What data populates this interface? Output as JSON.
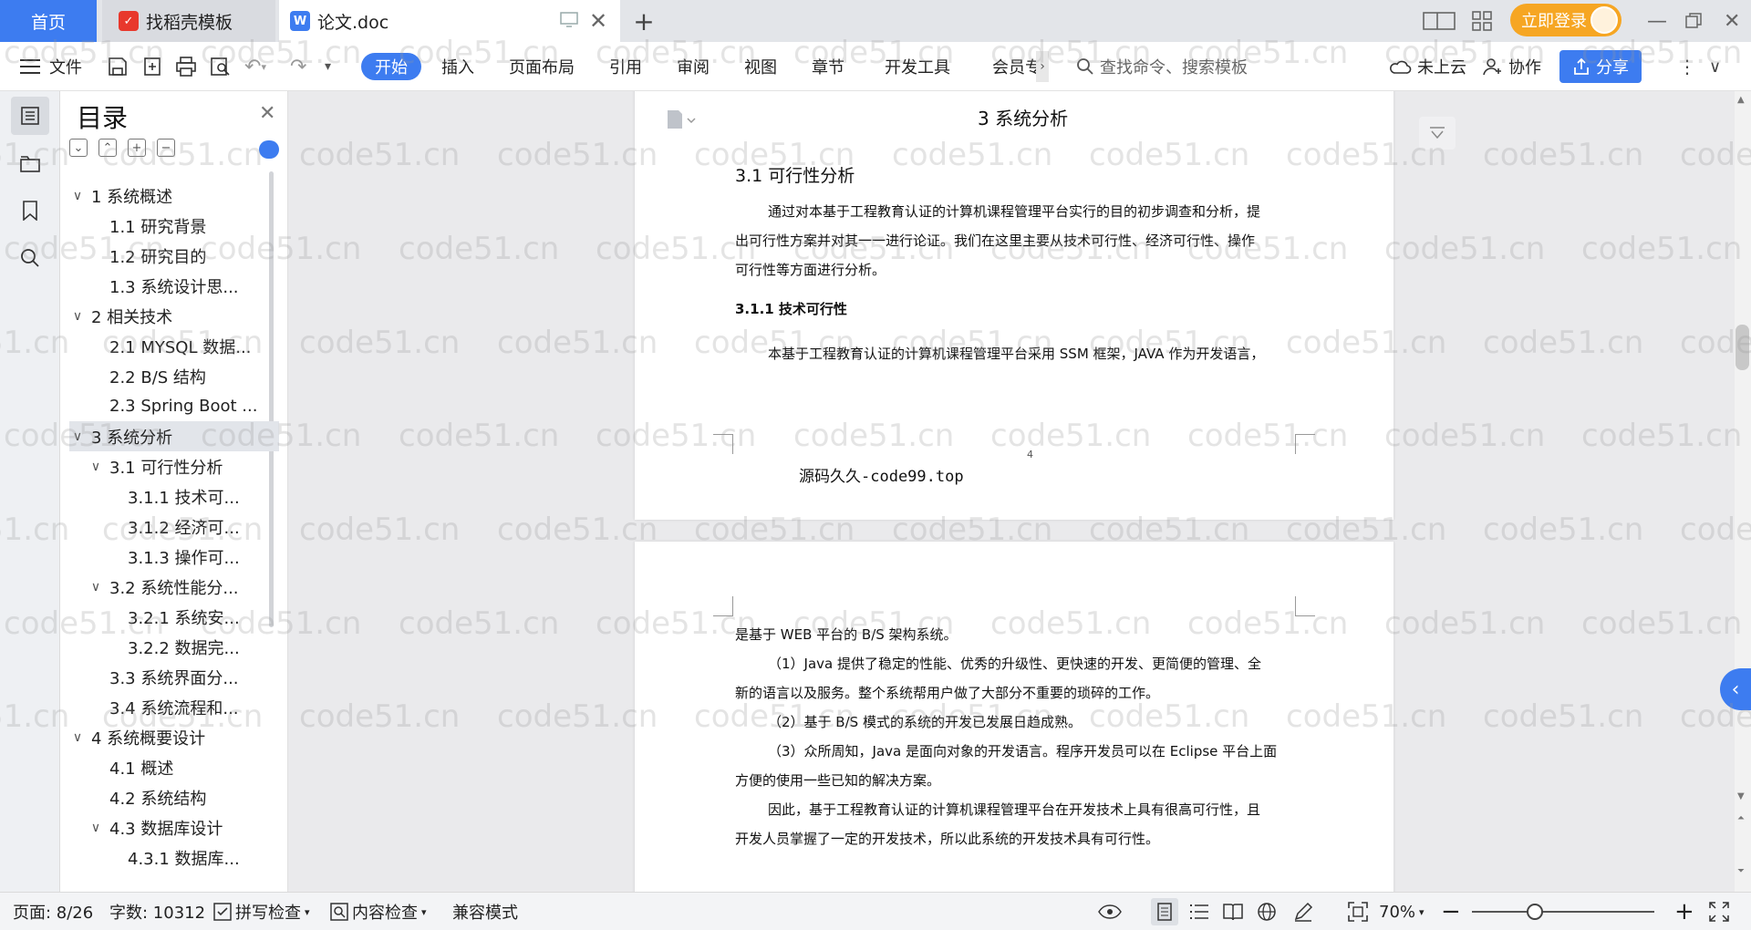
{
  "tabs": {
    "home": "首页",
    "template": "找稻壳模板",
    "document": "论文.doc",
    "new_tab": "+"
  },
  "account": {
    "login": "立即登录"
  },
  "toolbar": {
    "file": "文件",
    "menus": [
      "开始",
      "插入",
      "页面布局",
      "引用",
      "审阅",
      "视图",
      "章节",
      "开发工具",
      "会员专"
    ],
    "search_placeholder": "查找命令、搜索模板",
    "cloud": "未上云",
    "collab": "协作",
    "share": "分享"
  },
  "toc": {
    "title": "目录",
    "items": [
      {
        "label": "1 系统概述",
        "level": 1,
        "expanded": true
      },
      {
        "label": "1.1  研究背景",
        "level": 2
      },
      {
        "label": "1.2 研究目的",
        "level": 2
      },
      {
        "label": "1.3 系统设计思...",
        "level": 2
      },
      {
        "label": "2 相关技术",
        "level": 1,
        "expanded": true
      },
      {
        "label": "2.1 MYSQL 数据...",
        "level": 2
      },
      {
        "label": "2.2 B/S 结构",
        "level": 2
      },
      {
        "label": "2.3 Spring Boot ...",
        "level": 2
      },
      {
        "label": "3 系统分析",
        "level": 1,
        "expanded": true,
        "selected": true
      },
      {
        "label": "3.1 可行性分析",
        "level": 2,
        "expanded": true
      },
      {
        "label": "3.1.1 技术可...",
        "level": 3
      },
      {
        "label": "3.1.2 经济可...",
        "level": 3
      },
      {
        "label": "3.1.3 操作可...",
        "level": 3
      },
      {
        "label": "3.2 系统性能分...",
        "level": 2,
        "expanded": true
      },
      {
        "label": "3.2.1  系统安...",
        "level": 3
      },
      {
        "label": "3.2.2  数据完...",
        "level": 3
      },
      {
        "label": "3.3 系统界面分...",
        "level": 2
      },
      {
        "label": "3.4 系统流程和...",
        "level": 2
      },
      {
        "label": "4 系统概要设计",
        "level": 1,
        "expanded": true
      },
      {
        "label": "4.1 概述",
        "level": 2
      },
      {
        "label": "4.2 系统结构",
        "level": 2
      },
      {
        "label": "4.3 数据库设计",
        "level": 2,
        "expanded": true
      },
      {
        "label": "4.3.1 数据库...",
        "level": 3
      }
    ]
  },
  "document": {
    "page1": {
      "chapter_title": "3 系统分析",
      "section_title": "3.1 可行性分析",
      "para1": [
        "通过对本基于工程教育认证的计算机课程管理平台实行的目的初步调查和分析，提",
        "出可行性方案并对其一一进行论证。我们在这里主要从技术可行性、经济可行性、操作",
        "可行性等方面进行分析。"
      ],
      "subsection_title": "3.1.1 技术可行性",
      "para2": "本基于工程教育认证的计算机课程管理平台采用 SSM 框架，JAVA 作为开发语言，",
      "page_number": "4",
      "footer_text": "源码久久-code99.top"
    },
    "page2": {
      "lines": [
        "是基于 WEB 平台的 B/S 架构系统。",
        "（1）Java 提供了稳定的性能、优秀的升级性、更快速的开发、更简便的管理、全",
        "新的语言以及服务。整个系统帮用户做了大部分不重要的琐碎的工作。",
        "（2）基于 B/S 模式的系统的开发已发展日趋成熟。",
        "（3）众所周知，Java 是面向对象的开发语言。程序开发员可以在 Eclipse 平台上面",
        "方便的使用一些已知的解决方案。",
        "因此，基于工程教育认证的计算机课程管理平台在开发技术上具有很高可行性，且",
        "开发人员掌握了一定的开发技术，所以此系统的开发技术具有可行性。"
      ]
    }
  },
  "watermark": "code51.cn",
  "status": {
    "page": "页面: 8/26",
    "words": "字数: 10312",
    "spell_check": "拼写检查",
    "content_check": "内容检查",
    "compat_mode": "兼容模式",
    "zoom": "70%"
  },
  "colors": {
    "accent": "#3d7cf0",
    "login": "#f6a623"
  }
}
